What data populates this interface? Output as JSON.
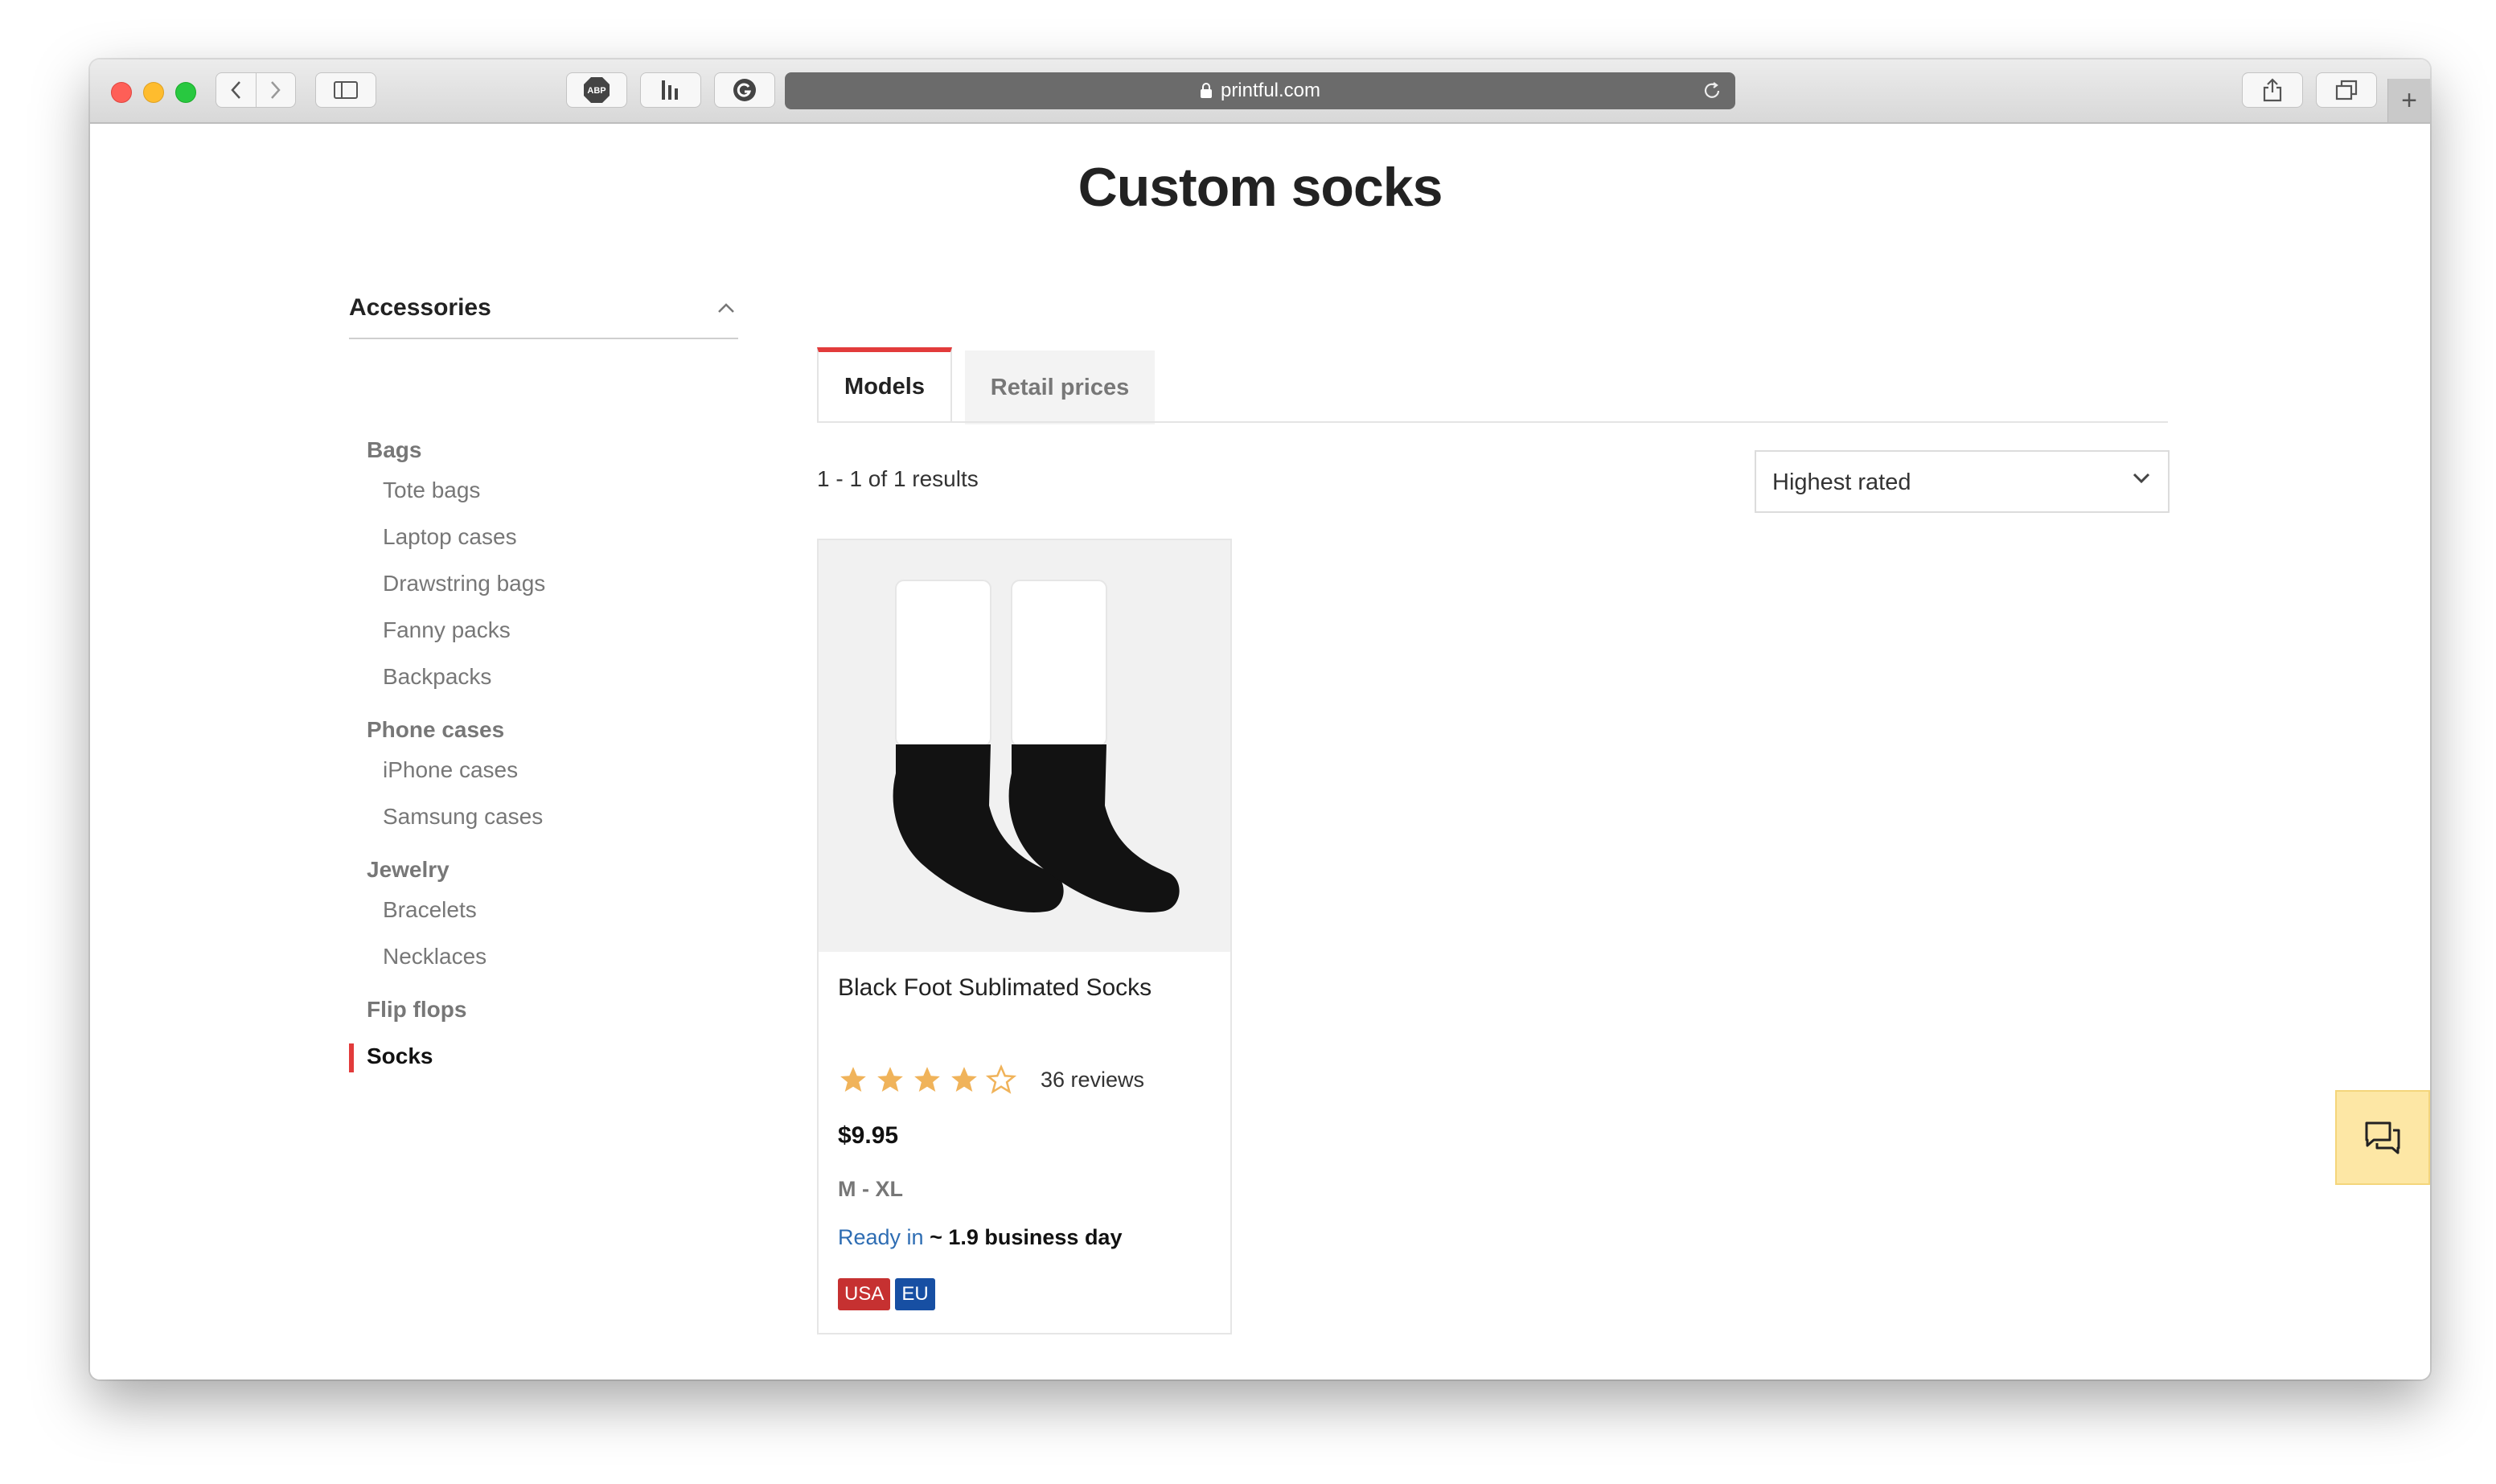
{
  "browser": {
    "url": "printful.com",
    "icons": [
      "back-icon",
      "forward-icon",
      "sidebar-icon",
      "adblock-icon",
      "bars-icon",
      "grammarly-icon",
      "lock-icon",
      "reload-icon",
      "share-icon",
      "tabs-icon",
      "new-tab-icon"
    ],
    "extension_abp_label": "ABP"
  },
  "page": {
    "title": "Custom socks"
  },
  "sidebar": {
    "heading": "Accessories",
    "groups": [
      {
        "label": "Bags",
        "items": [
          "Tote bags",
          "Laptop cases",
          "Drawstring bags",
          "Fanny packs",
          "Backpacks"
        ]
      },
      {
        "label": "Phone cases",
        "items": [
          "iPhone cases",
          "Samsung cases"
        ]
      },
      {
        "label": "Jewelry",
        "items": [
          "Bracelets",
          "Necklaces"
        ]
      },
      {
        "label": "Flip flops",
        "items": []
      },
      {
        "label": "Socks",
        "items": [],
        "active": true
      }
    ]
  },
  "tabs": [
    {
      "label": "Models",
      "active": true
    },
    {
      "label": "Retail prices",
      "active": false
    }
  ],
  "results": {
    "text": "1 - 1 of 1 results"
  },
  "sort": {
    "selected": "Highest rated"
  },
  "product": {
    "name": "Black Foot Sublimated Socks",
    "rating": 4,
    "rating_max": 5,
    "reviews": "36 reviews",
    "price": "$9.95",
    "sizes": "M - XL",
    "ready_label": "Ready in",
    "ready_value": "~ 1.9 business day",
    "badges": [
      {
        "label": "USA",
        "color": "#c63131"
      },
      {
        "label": "EU",
        "color": "#174fa3"
      }
    ]
  },
  "colors": {
    "accent": "#e23b3b",
    "star": "#f0b35a",
    "link": "#2e6db3",
    "chat_bg": "#fde7a5"
  }
}
